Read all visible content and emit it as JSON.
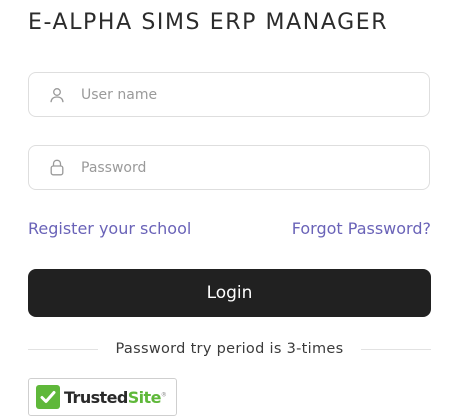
{
  "app": {
    "title": "E-ALPHA SIMS ERP MANAGER"
  },
  "form": {
    "username": {
      "placeholder": "User name",
      "value": "",
      "icon": "user-icon"
    },
    "password": {
      "placeholder": "Password",
      "value": "",
      "icon": "lock-icon"
    },
    "register_label": "Register your school",
    "forgot_label": "Forgot Password?",
    "login_label": "Login",
    "notice": "Password try period is 3-times"
  },
  "badge": {
    "part1": "Trusted",
    "part2": "Site",
    "mark": "®",
    "icon": "checkmark-icon"
  },
  "colors": {
    "link": "#6a63b8",
    "button": "#212121",
    "badge_green": "#5fb83a"
  }
}
